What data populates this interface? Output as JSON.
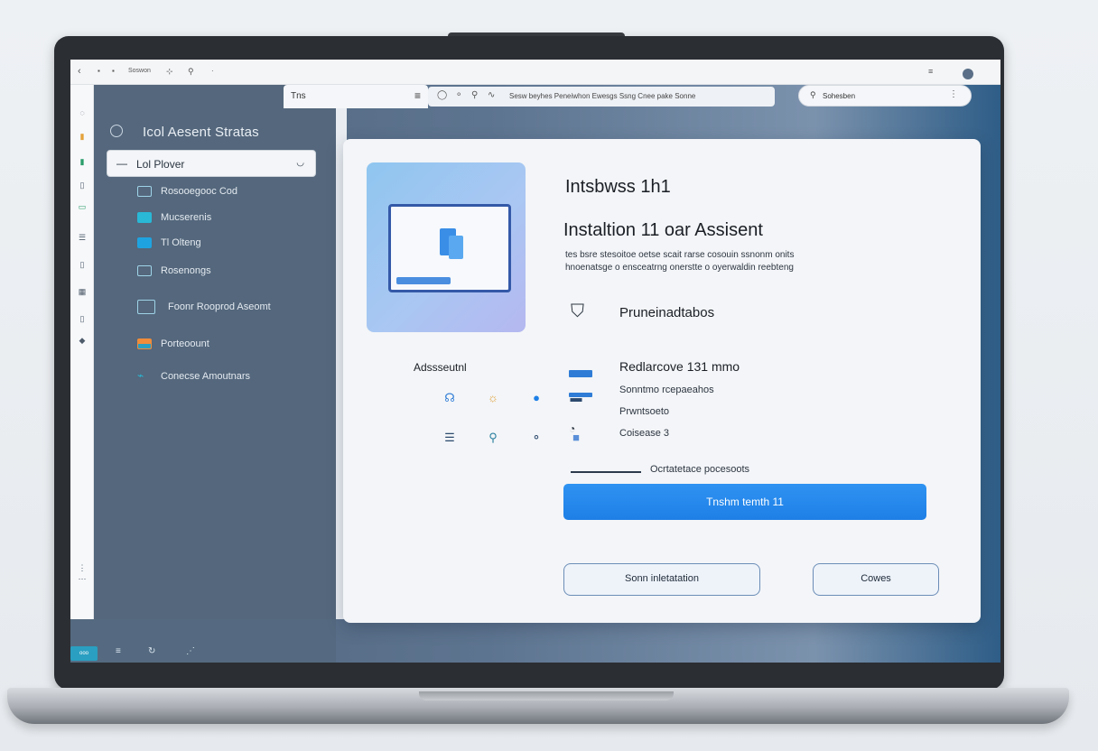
{
  "browser": {
    "back_icon": "chevron-left-icon",
    "top_text": "Soswon",
    "active_tab": "Tns",
    "toolbar_text": "Sesw beyhes Peneiwhon Ewesgs  Ssng Cnee pake Sonne",
    "search_text": "Sohesben"
  },
  "sidebar": {
    "title": "Icol Aesent Stratas",
    "dropdown_prefix": "—",
    "dropdown_label": "Lol Plover",
    "items": [
      {
        "label": "Rosooegooc Cod",
        "icon": "folder-icon",
        "color": "#9fd3e8"
      },
      {
        "label": "Mucserenis",
        "icon": "monitor-icon",
        "color": "#29b8d6"
      },
      {
        "label": "Tl Olteng",
        "icon": "window-icon",
        "color": "#1fa3e0"
      },
      {
        "label": "Rosenongs",
        "icon": "display-icon",
        "color": "#9fd3e8"
      },
      {
        "label": "Foonr Rooprod Aseomt",
        "icon": "laptop-icon",
        "color": "#9fd3e8"
      },
      {
        "label": "Porteoount",
        "icon": "card-icon",
        "color": "#f08c3a"
      },
      {
        "label": "Conecse Amoutnars",
        "icon": "link-icon",
        "color": "#29b8d6"
      }
    ],
    "footer_button": "ooo"
  },
  "dialog": {
    "heading1": "Intsbwss 1h1",
    "heading2": "Instaltion 11 oar Assisent",
    "description": "tes bsre stesoitoe oetse scait rarse cosouin ssnonm onits hnoenatsge o ensceatrng onerstte o oyerwaldin reebteng",
    "assist_label": "Adssseutnl",
    "permissions_title": "Pruneinadtabos",
    "requirements_title": "Redlarcove 131 mmo",
    "requirements": [
      "Sonntmo rcepaeahos",
      "Prwntsoeto",
      "Coisease 3"
    ],
    "progress_label": "Ocrtatetace pocesoots",
    "progress_value": 0.18,
    "primary_button": "Tnshm temth 11",
    "secondary_button": "Sonn inletatation",
    "cancel_button": "Cowes",
    "accent_color": "#1e7fe6"
  }
}
